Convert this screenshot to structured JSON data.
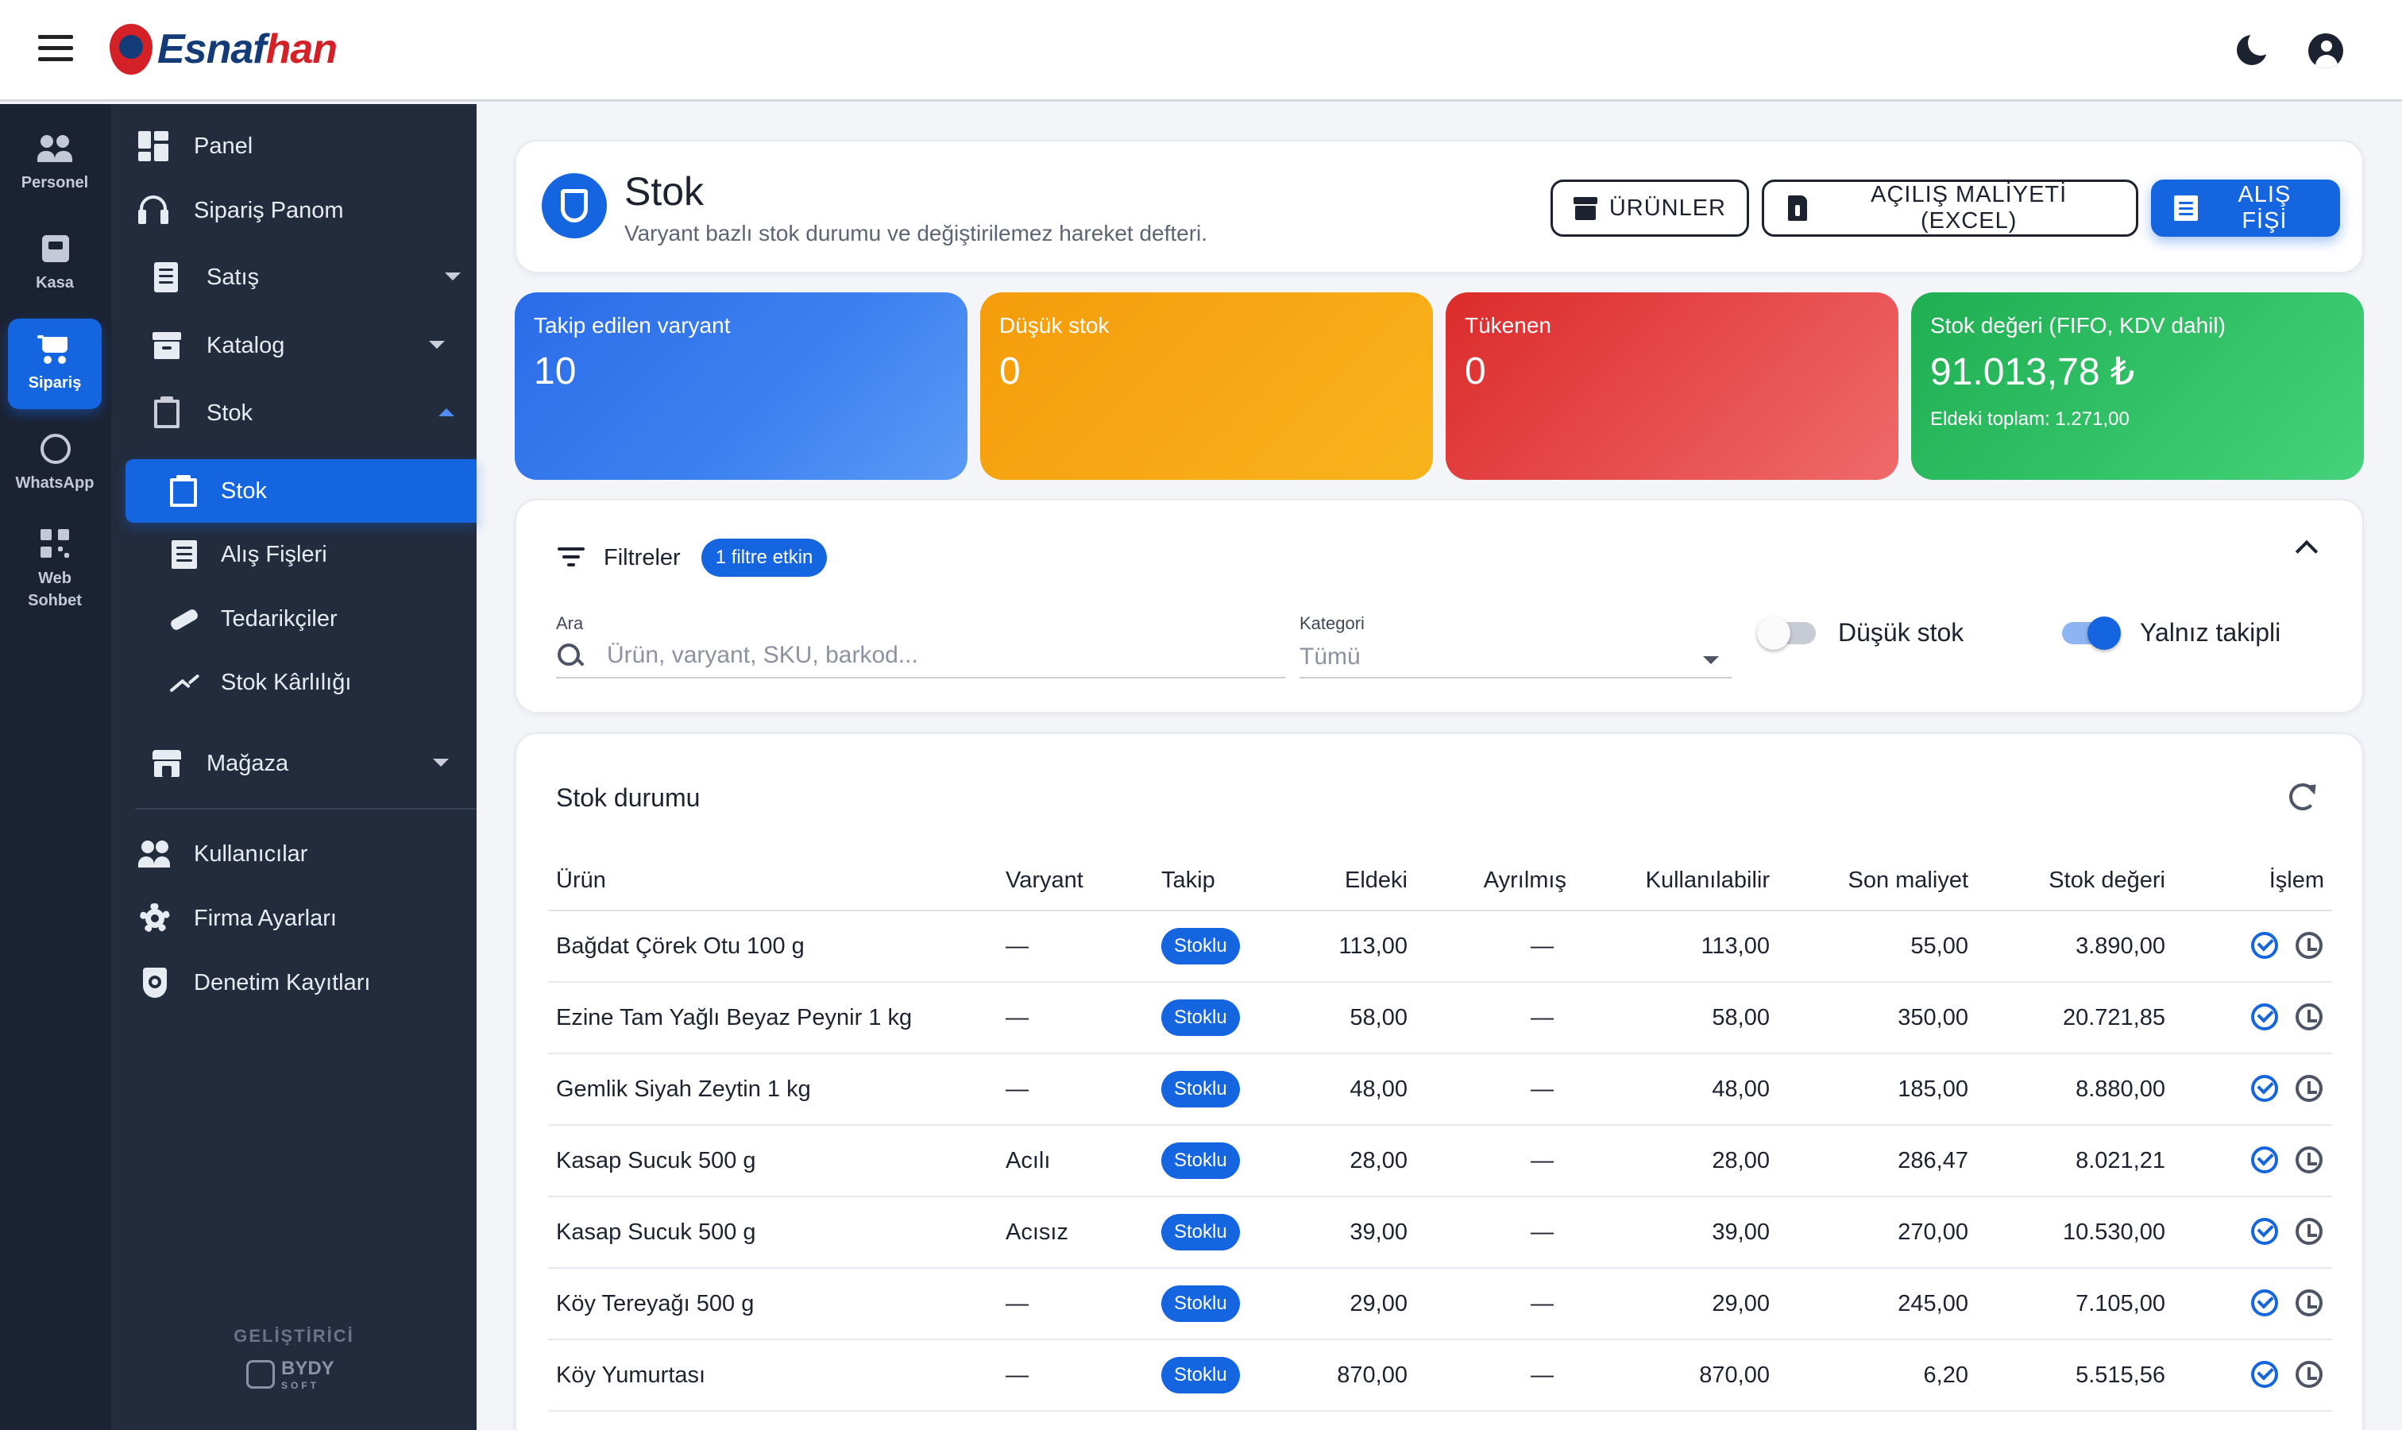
{
  "brand": {
    "part1": "Esnaf",
    "part2": "han"
  },
  "rail": [
    {
      "label": "Personel",
      "icon": "people-icon"
    },
    {
      "label": "Kasa",
      "icon": "cash-register-icon"
    },
    {
      "label": "Sipariş",
      "icon": "cart-icon",
      "active": true
    },
    {
      "label": "WhatsApp",
      "icon": "whatsapp-icon"
    },
    {
      "label": "Web Sohbet",
      "icon": "qr-code-icon"
    }
  ],
  "sidebar": {
    "items": [
      {
        "label": "Panel",
        "icon": "dashboard-icon"
      },
      {
        "label": "Sipariş Panom",
        "icon": "headset-icon"
      },
      {
        "label": "Satış",
        "icon": "receipt-icon"
      },
      {
        "label": "Katalog",
        "icon": "archive-icon"
      },
      {
        "label": "Stok",
        "icon": "clipboard-icon"
      },
      {
        "label": "Mağaza",
        "icon": "store-icon"
      },
      {
        "label": "Kullanıcılar",
        "icon": "users-icon"
      },
      {
        "label": "Firma Ayarları",
        "icon": "gear-icon"
      },
      {
        "label": "Denetim Kayıtları",
        "icon": "shield-icon"
      }
    ],
    "stok_sub": [
      {
        "label": "Stok",
        "icon": "clipboard-check-icon"
      },
      {
        "label": "Alış Fişleri",
        "icon": "list-icon"
      },
      {
        "label": "Tedarikçiler",
        "icon": "handshake-icon"
      },
      {
        "label": "Stok Kârlılığı",
        "icon": "trend-up-icon"
      }
    ],
    "developer_label": "GELİŞTİRİCİ",
    "developer_name": "BYDY",
    "developer_sub": "SOFT"
  },
  "header": {
    "title": "Stok",
    "subtitle": "Varyant bazlı stok durumu ve değiştirilemez hareket defteri.",
    "btn_products": "ÜRÜNLER",
    "btn_opening_cost": "AÇILIŞ MALİYETİ (EXCEL)",
    "btn_purchase": "ALIŞ FİŞİ"
  },
  "stats": {
    "tracked": {
      "label": "Takip edilen varyant",
      "value": "10"
    },
    "low": {
      "label": "Düşük stok",
      "value": "0"
    },
    "out": {
      "label": "Tükenen",
      "value": "0"
    },
    "value": {
      "label": "Stok değeri (FIFO, KDV dahil)",
      "value": "91.013,78 ₺",
      "extra": "Eldeki toplam: 1.271,00"
    }
  },
  "filters": {
    "title": "Filtreler",
    "active_badge": "1 filtre etkin",
    "search_label": "Ara",
    "search_placeholder": "Ürün, varyant, SKU, barkod...",
    "category_label": "Kategori",
    "category_value": "Tümü",
    "low_stock_label": "Düşük stok",
    "only_tracked_label": "Yalnız takipli"
  },
  "table": {
    "title": "Stok durumu",
    "headers": [
      "Ürün",
      "Varyant",
      "Takip",
      "Eldeki",
      "Ayrılmış",
      "Kullanılabilir",
      "Son maliyet",
      "Stok değeri",
      "İşlem"
    ],
    "rows": [
      [
        "Bağdat Çörek Otu 100 g",
        "—",
        "Stoklu",
        "113,00",
        "—",
        "113,00",
        "55,00",
        "3.890,00"
      ],
      [
        "Ezine Tam Yağlı Beyaz Peynir 1 kg",
        "—",
        "Stoklu",
        "58,00",
        "—",
        "58,00",
        "350,00",
        "20.721,85"
      ],
      [
        "Gemlik Siyah Zeytin 1 kg",
        "—",
        "Stoklu",
        "48,00",
        "—",
        "48,00",
        "185,00",
        "8.880,00"
      ],
      [
        "Kasap Sucuk 500 g",
        "Acılı",
        "Stoklu",
        "28,00",
        "—",
        "28,00",
        "286,47",
        "8.021,21"
      ],
      [
        "Kasap Sucuk 500 g",
        "Acısız",
        "Stoklu",
        "39,00",
        "—",
        "39,00",
        "270,00",
        "10.530,00"
      ],
      [
        "Köy Tereyağı 500 g",
        "—",
        "Stoklu",
        "29,00",
        "—",
        "29,00",
        "245,00",
        "7.105,00"
      ],
      [
        "Köy Yumurtası",
        "—",
        "Stoklu",
        "870,00",
        "—",
        "870,00",
        "6,20",
        "5.515,56"
      ]
    ]
  },
  "colors": {
    "primary": "#1565e0",
    "sidebar": "#232c3d",
    "rail": "#1b2232"
  }
}
